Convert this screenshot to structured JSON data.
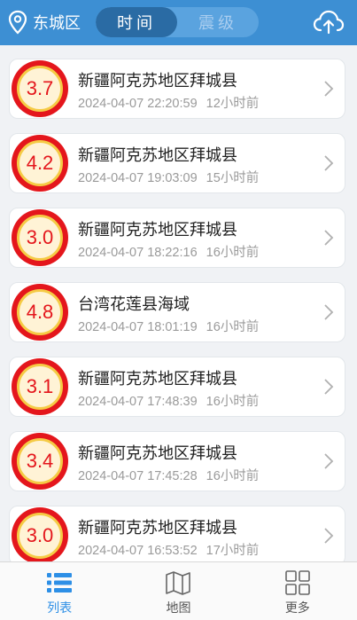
{
  "header": {
    "location": "东城区",
    "segments": [
      {
        "label": "时间",
        "active": true
      },
      {
        "label": "震级",
        "active": false
      }
    ],
    "upload_icon": "cloud-upload-icon",
    "location_icon": "map-pin-icon"
  },
  "quakes": [
    {
      "magnitude": "3.7",
      "place": "新疆阿克苏地区拜城县",
      "time": "2024-04-07 22:20:59",
      "ago": "12小时前"
    },
    {
      "magnitude": "4.2",
      "place": "新疆阿克苏地区拜城县",
      "time": "2024-04-07 19:03:09",
      "ago": "15小时前"
    },
    {
      "magnitude": "3.0",
      "place": "新疆阿克苏地区拜城县",
      "time": "2024-04-07 18:22:16",
      "ago": "16小时前"
    },
    {
      "magnitude": "4.8",
      "place": "台湾花莲县海域",
      "time": "2024-04-07 18:01:19",
      "ago": "16小时前"
    },
    {
      "magnitude": "3.1",
      "place": "新疆阿克苏地区拜城县",
      "time": "2024-04-07 17:48:39",
      "ago": "16小时前"
    },
    {
      "magnitude": "3.4",
      "place": "新疆阿克苏地区拜城县",
      "time": "2024-04-07 17:45:28",
      "ago": "16小时前"
    },
    {
      "magnitude": "3.0",
      "place": "新疆阿克苏地区拜城县",
      "time": "2024-04-07 16:53:52",
      "ago": "17小时前"
    }
  ],
  "tabs": [
    {
      "label": "列表",
      "icon": "list-icon",
      "active": true
    },
    {
      "label": "地图",
      "icon": "map-icon",
      "active": false
    },
    {
      "label": "更多",
      "icon": "grid-icon",
      "active": false
    }
  ],
  "colors": {
    "header": "#3d8fd3",
    "badge_red": "#e4161c",
    "badge_ring": "#f5cb45",
    "tab_active": "#2d8fe6"
  }
}
